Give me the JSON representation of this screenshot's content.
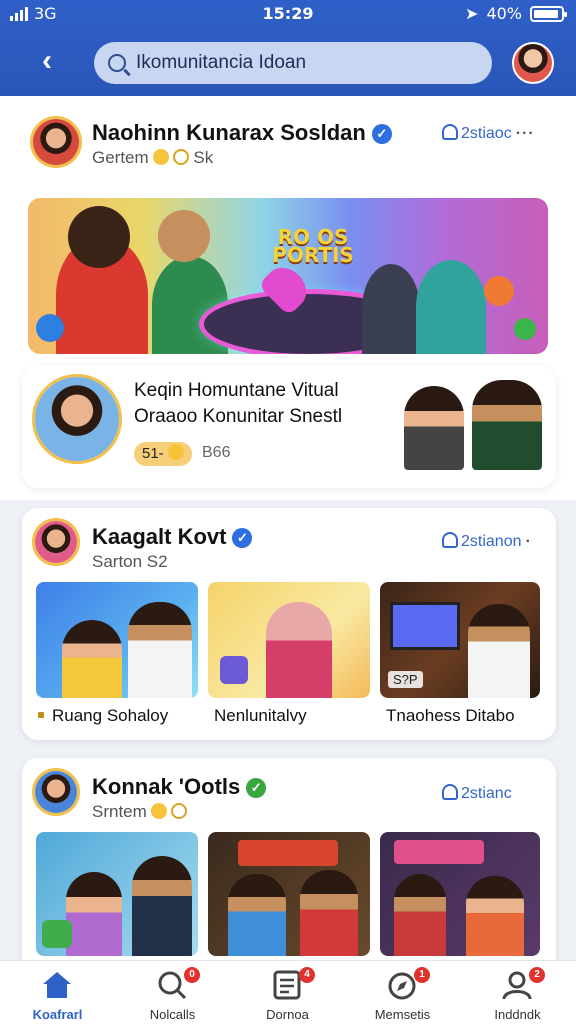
{
  "status_bar": {
    "carrier": "3G",
    "time": "15:29",
    "battery": "40%"
  },
  "header": {
    "search_placeholder": "Ikomunitancia Idoan"
  },
  "posts": [
    {
      "name": "Naohinn Kunarax Sosldan",
      "subtitle": "Gertem",
      "subtitle_extra": "Sk",
      "follow": "2stiaoc",
      "banner_title": "RO OS PORTIS",
      "feature": {
        "line1": "Keqin Homuntane Vitual",
        "line2": "Oraaoo Konunitar Snestl",
        "pill": "51-",
        "count": "B66"
      }
    },
    {
      "name": "Kaagalt Kovt",
      "subtitle": "Sarton S2",
      "follow": "2stianon",
      "items": [
        {
          "label": "Ruang Sohaloy"
        },
        {
          "label": "Nenlunitalvy"
        },
        {
          "label": "Tnaohess Ditabo",
          "tag": "S?P"
        }
      ]
    },
    {
      "name": "Konnak 'Ootls",
      "subtitle": "Srntem",
      "follow": "2stianc"
    }
  ],
  "bottom_nav": [
    {
      "label": "Koafrarl",
      "icon": "home-icon",
      "active": true
    },
    {
      "label": "Nolcalls",
      "icon": "search-icon",
      "badge": "0"
    },
    {
      "label": "Dornoa",
      "icon": "feed-icon",
      "badge": "4"
    },
    {
      "label": "Memsetis",
      "icon": "compass-icon",
      "badge": "1"
    },
    {
      "label": "Inddndk",
      "icon": "profile-icon",
      "badge": "2"
    }
  ],
  "colors": {
    "header_blue": "#2f5fc8",
    "verified_blue": "#2d6fe0",
    "verified_green": "#3aa63f",
    "accent": "#3366cc"
  }
}
